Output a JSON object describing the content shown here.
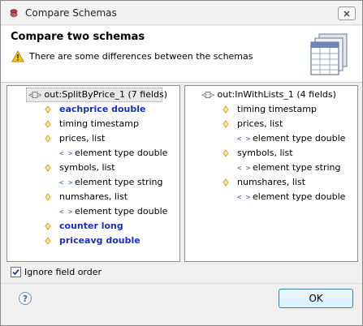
{
  "window": {
    "title": "Compare Schemas"
  },
  "header": {
    "heading": "Compare two schemas",
    "message": "There are some differences between the schemas"
  },
  "left_panel": {
    "root": "out:SplitByPrice_1 (7 fields)",
    "rows": [
      {
        "text": "eachprice double",
        "diff": true,
        "kind": "field",
        "level": 1
      },
      {
        "text": "timing timestamp",
        "diff": false,
        "kind": "field",
        "level": 1
      },
      {
        "text": "prices, list",
        "diff": false,
        "kind": "field",
        "level": 1
      },
      {
        "text": "element type double",
        "diff": false,
        "kind": "element",
        "level": 2
      },
      {
        "text": "symbols, list",
        "diff": false,
        "kind": "field",
        "level": 1
      },
      {
        "text": "element type string",
        "diff": false,
        "kind": "element",
        "level": 2
      },
      {
        "text": "numshares, list",
        "diff": false,
        "kind": "field",
        "level": 1
      },
      {
        "text": "element type double",
        "diff": false,
        "kind": "element",
        "level": 2
      },
      {
        "text": "counter long",
        "diff": true,
        "kind": "field",
        "level": 1
      },
      {
        "text": "priceavg double",
        "diff": true,
        "kind": "field",
        "level": 1
      }
    ]
  },
  "right_panel": {
    "root": "out:InWithLists_1 (4 fields)",
    "rows": [
      {
        "text": "timing timestamp",
        "diff": false,
        "kind": "field",
        "level": 1
      },
      {
        "text": "prices, list",
        "diff": false,
        "kind": "field",
        "level": 1
      },
      {
        "text": "element type double",
        "diff": false,
        "kind": "element",
        "level": 2
      },
      {
        "text": "symbols, list",
        "diff": false,
        "kind": "field",
        "level": 1
      },
      {
        "text": "element type string",
        "diff": false,
        "kind": "element",
        "level": 2
      },
      {
        "text": "numshares, list",
        "diff": false,
        "kind": "field",
        "level": 1
      },
      {
        "text": "element type double",
        "diff": false,
        "kind": "element",
        "level": 2
      }
    ]
  },
  "options": {
    "ignore_field_order_label": "Ignore field order",
    "ignore_field_order_checked": true
  },
  "footer": {
    "ok_label": "OK",
    "help_glyph": "?"
  },
  "colors": {
    "diff_text": "#1a2ec4",
    "field_diamond": "#e0a020",
    "element_brackets": "#3060b0"
  },
  "icons": {
    "app": "compare-schemas-app-icon",
    "close": "close-icon",
    "warning": "warning-icon",
    "banner": "schema-tables-banner-icon",
    "root": "schema-root-icon",
    "field": "field-diamond-icon",
    "element": "element-brackets-icon",
    "help": "help-icon"
  }
}
